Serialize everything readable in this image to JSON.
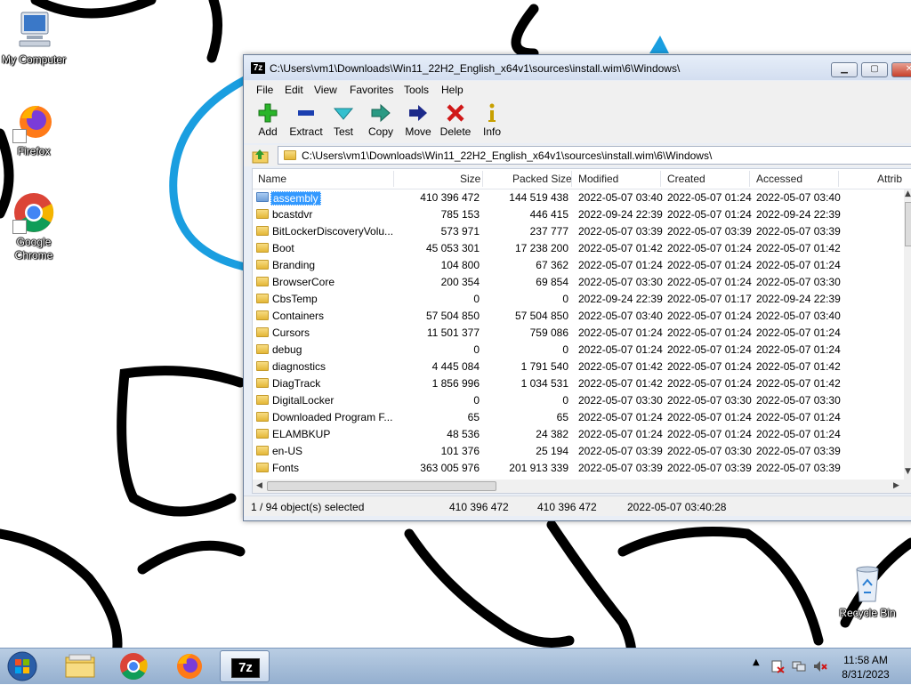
{
  "desktop": {
    "icons": [
      {
        "label": "My Computer"
      },
      {
        "label": "Firefox"
      },
      {
        "label": "Google Chrome"
      },
      {
        "label": "Recycle Bin"
      }
    ]
  },
  "window": {
    "app_icon": "7z",
    "title": "C:\\Users\\vm1\\Downloads\\Win11_22H2_English_x64v1\\sources\\install.wim\\6\\Windows\\",
    "menu": [
      "File",
      "Edit",
      "View",
      "Favorites",
      "Tools",
      "Help"
    ],
    "toolbar": [
      {
        "label": "Add",
        "icon": "plus-icon",
        "color": "#22aa22"
      },
      {
        "label": "Extract",
        "icon": "minus-icon",
        "color": "#1b3fb0"
      },
      {
        "label": "Test",
        "icon": "check-arrow-icon",
        "color": "#22a5b5"
      },
      {
        "label": "Copy",
        "icon": "double-arrow-icon",
        "color": "#1f8f7a"
      },
      {
        "label": "Move",
        "icon": "arrow-right-icon",
        "color": "#1d2a8a"
      },
      {
        "label": "Delete",
        "icon": "x-icon",
        "color": "#d01818"
      },
      {
        "label": "Info",
        "icon": "info-icon",
        "color": "#c8a000"
      }
    ],
    "address": "C:\\Users\\vm1\\Downloads\\Win11_22H2_English_x64v1\\sources\\install.wim\\6\\Windows\\",
    "columns": [
      "Name",
      "Size",
      "Packed Size",
      "Modified",
      "Created",
      "Accessed",
      "Attrib"
    ],
    "rows": [
      {
        "name": "assembly",
        "size": "410 396 472",
        "packed": "144 519 438",
        "modified": "2022-05-07 03:40",
        "created": "2022-05-07 01:24",
        "accessed": "2022-05-07 03:40",
        "selected": true
      },
      {
        "name": "bcastdvr",
        "size": "785 153",
        "packed": "446 415",
        "modified": "2022-09-24 22:39",
        "created": "2022-05-07 01:24",
        "accessed": "2022-09-24 22:39"
      },
      {
        "name": "BitLockerDiscoveryVolu...",
        "size": "573 971",
        "packed": "237 777",
        "modified": "2022-05-07 03:39",
        "created": "2022-05-07 03:39",
        "accessed": "2022-05-07 03:39"
      },
      {
        "name": "Boot",
        "size": "45 053 301",
        "packed": "17 238 200",
        "modified": "2022-05-07 01:42",
        "created": "2022-05-07 01:24",
        "accessed": "2022-05-07 01:42"
      },
      {
        "name": "Branding",
        "size": "104 800",
        "packed": "67 362",
        "modified": "2022-05-07 01:24",
        "created": "2022-05-07 01:24",
        "accessed": "2022-05-07 01:24"
      },
      {
        "name": "BrowserCore",
        "size": "200 354",
        "packed": "69 854",
        "modified": "2022-05-07 03:30",
        "created": "2022-05-07 01:24",
        "accessed": "2022-05-07 03:30"
      },
      {
        "name": "CbsTemp",
        "size": "0",
        "packed": "0",
        "modified": "2022-09-24 22:39",
        "created": "2022-05-07 01:17",
        "accessed": "2022-09-24 22:39"
      },
      {
        "name": "Containers",
        "size": "57 504 850",
        "packed": "57 504 850",
        "modified": "2022-05-07 03:40",
        "created": "2022-05-07 01:24",
        "accessed": "2022-05-07 03:40"
      },
      {
        "name": "Cursors",
        "size": "11 501 377",
        "packed": "759 086",
        "modified": "2022-05-07 01:24",
        "created": "2022-05-07 01:24",
        "accessed": "2022-05-07 01:24"
      },
      {
        "name": "debug",
        "size": "0",
        "packed": "0",
        "modified": "2022-05-07 01:24",
        "created": "2022-05-07 01:24",
        "accessed": "2022-05-07 01:24"
      },
      {
        "name": "diagnostics",
        "size": "4 445 084",
        "packed": "1 791 540",
        "modified": "2022-05-07 01:42",
        "created": "2022-05-07 01:24",
        "accessed": "2022-05-07 01:42"
      },
      {
        "name": "DiagTrack",
        "size": "1 856 996",
        "packed": "1 034 531",
        "modified": "2022-05-07 01:42",
        "created": "2022-05-07 01:24",
        "accessed": "2022-05-07 01:42"
      },
      {
        "name": "DigitalLocker",
        "size": "0",
        "packed": "0",
        "modified": "2022-05-07 03:30",
        "created": "2022-05-07 03:30",
        "accessed": "2022-05-07 03:30"
      },
      {
        "name": "Downloaded Program F...",
        "size": "65",
        "packed": "65",
        "modified": "2022-05-07 01:24",
        "created": "2022-05-07 01:24",
        "accessed": "2022-05-07 01:24"
      },
      {
        "name": "ELAMBKUP",
        "size": "48 536",
        "packed": "24 382",
        "modified": "2022-05-07 01:24",
        "created": "2022-05-07 01:24",
        "accessed": "2022-05-07 01:24"
      },
      {
        "name": "en-US",
        "size": "101 376",
        "packed": "25 194",
        "modified": "2022-05-07 03:39",
        "created": "2022-05-07 03:30",
        "accessed": "2022-05-07 03:39"
      },
      {
        "name": "Fonts",
        "size": "363 005 976",
        "packed": "201 913 339",
        "modified": "2022-05-07 03:39",
        "created": "2022-05-07 03:39",
        "accessed": "2022-05-07 03:39"
      }
    ],
    "status": {
      "selection": "1 / 94 object(s) selected",
      "size": "410 396 472",
      "packed": "410 396 472",
      "modified": "2022-05-07 03:40:28"
    }
  },
  "taskbar": {
    "apps": [
      "windows-explorer-icon",
      "chrome-icon",
      "firefox-icon",
      "7zip-icon"
    ],
    "active_app_label": "7z",
    "clock_time": "11:58 AM",
    "clock_date": "8/31/2023"
  }
}
